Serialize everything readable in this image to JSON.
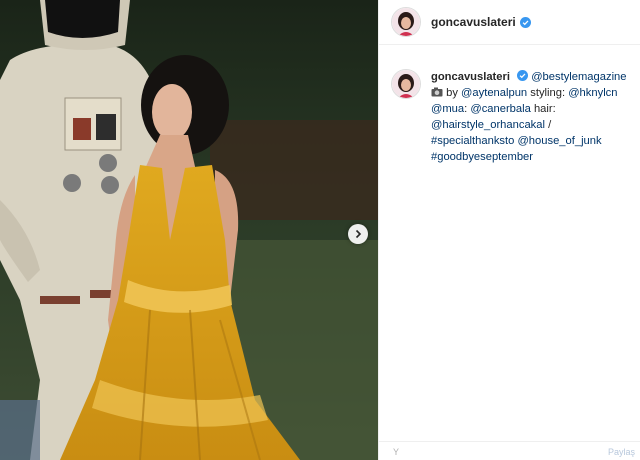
{
  "post": {
    "username": "goncavuslateri",
    "caption": {
      "mention_1": "@bestylemagazine",
      "by_text": "by",
      "mention_2": "@aytenalpun",
      "styling_text": "styling:",
      "mention_3": "@hknylcn",
      "mention_4": "@mua",
      "colon_text": ":",
      "mention_5": "@canerbala",
      "hair_text": "hair:",
      "mention_6": "@hairstyle_orhancakal",
      "slash_text": "/",
      "hashtag_1": "#specialthanksto",
      "mention_7": "@house_of_junk",
      "hashtag_2": "#goodbyeseptember"
    },
    "comment_placeholder": "Y",
    "share_label": "Paylaş"
  },
  "colors": {
    "link": "#003569",
    "verified": "#3897f0",
    "dress": "#d9a21a"
  },
  "icons": [
    "verified-badge-icon",
    "camera-emoji-icon",
    "chevron-right-icon"
  ]
}
